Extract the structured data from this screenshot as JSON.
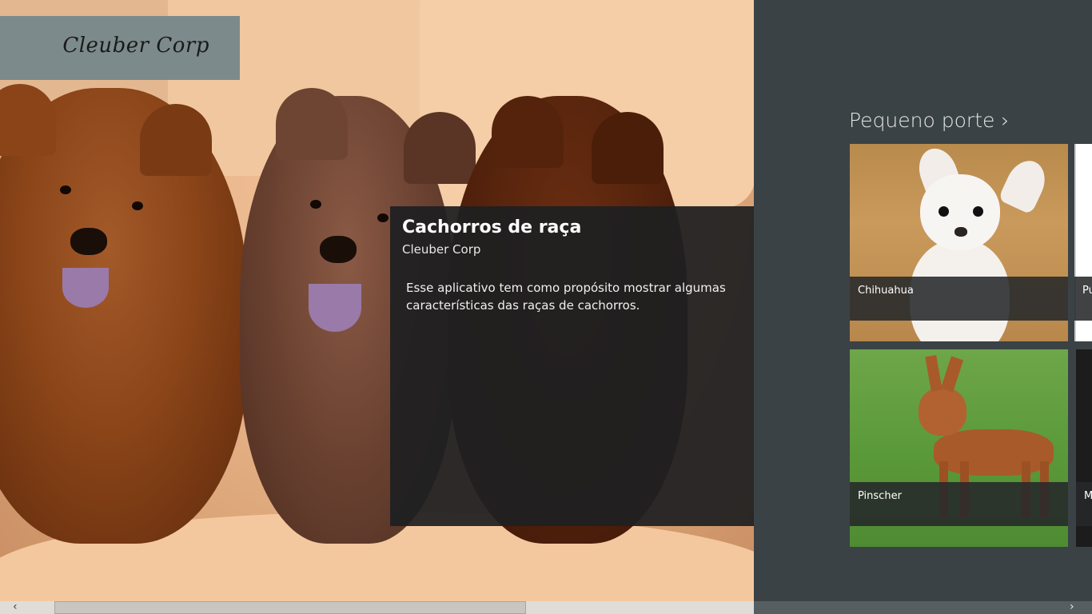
{
  "brand": {
    "name": "Cleuber Corp"
  },
  "info": {
    "title": "Cachorros de raça",
    "subtitle": "Cleuber Corp",
    "description": "Esse aplicativo tem como propósito mostrar algumas características das raças de cachorros."
  },
  "section": {
    "title": "Pequeno porte ›"
  },
  "tiles": [
    {
      "label": "Chihuahua"
    },
    {
      "label": "Pu"
    },
    {
      "label": "Pinscher"
    },
    {
      "label": "M"
    }
  ],
  "scroll": {
    "left_arrow": "‹",
    "right_arrow": "›"
  }
}
